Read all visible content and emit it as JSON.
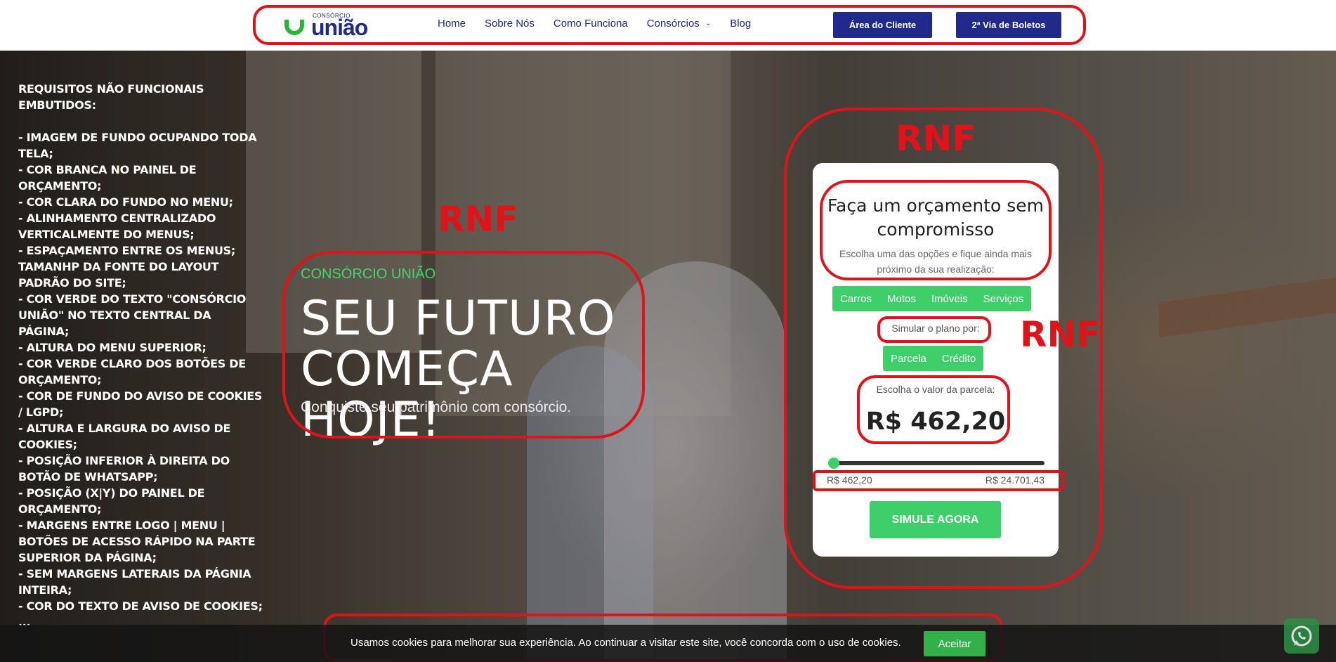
{
  "header": {
    "logo_small": "CONSÓRCIO",
    "logo_big": "união",
    "nav": [
      {
        "label": "Home"
      },
      {
        "label": "Sobre Nós"
      },
      {
        "label": "Como Funciona"
      },
      {
        "label": "Consórcios"
      },
      {
        "label": "Blog"
      }
    ],
    "btn_area_cliente": "Área do Cliente",
    "btn_boletos": "2ª Via de Boletos"
  },
  "requirements": {
    "title": "REQUISITOS NÃO FUNCIONAIS EMBUTIDOS:",
    "items": [
      "- IMAGEM DE FUNDO OCUPANDO TODA TELA;",
      "- COR BRANCA NO PAINEL DE ORÇAMENTO;",
      "- COR CLARA DO FUNDO NO MENU;",
      "- ALINHAMENTO CENTRALIZADO VERTICALMENTE DO MENUS;",
      "- ESPAÇAMENTO ENTRE OS MENUS; TAMANHP DA FONTE DO LAYOUT PADRÃO DO SITE;",
      "- COR VERDE DO TEXTO \"CONSÓRCIO UNIÃO\" NO TEXTO CENTRAL DA PÁGINA;",
      "- ALTURA DO MENU SUPERIOR;",
      "- COR VERDE CLARO DOS BOTÕES DE ORÇAMENTO;",
      "- COR DE FUNDO DO AVISO DE COOKIES / LGPD;",
      "- ALTURA E LARGURA DO AVISO DE COOKIES;",
      "- POSIÇÃO INFERIOR À DIREITA DO BOTÃO DE WHATSAPP;",
      "- POSIÇÃO (X|Y) DO PAINEL DE ORÇAMENTO;",
      "- MARGENS ENTRE LOGO | MENU | BOTÕES DE ACESSO RÁPIDO NA PARTE SUPERIOR DA PÁGINA;",
      "- SEM MARGENS LATERAIS DA PÁGNIA INTEIRA;",
      "- COR DO TEXTO DE AVISO DE COOKIES; ..."
    ]
  },
  "hero": {
    "brand": "CONSÓRCIO UNIÃO",
    "title_line1": "SEU FUTURO",
    "title_line2": "COMEÇA HOJE!",
    "subtitle": "Conquiste seu patrimônio com consórcio."
  },
  "annotations": {
    "rnf_hero": "RNF",
    "rnf_panel_top": "RNF",
    "rnf_panel_side": "RNF"
  },
  "panel": {
    "title_line1": "Faça um orçamento sem",
    "title_line2": "compromisso",
    "description": "Escolha uma das opções e fique ainda mais próximo da sua realização:",
    "categories": [
      {
        "label": "Carros"
      },
      {
        "label": "Motos"
      },
      {
        "label": "Imóveis"
      },
      {
        "label": "Serviços"
      }
    ],
    "plan_label": "Simular o plano por:",
    "plan_options": [
      {
        "label": "Parcela"
      },
      {
        "label": "Crédito"
      }
    ],
    "value_label": "Escolha o valor da parcela:",
    "amount": "R$ 462,20",
    "slider_fraction": 0.0,
    "range_min": "R$ 462,20",
    "range_max": "R$ 24.701,43",
    "cta": "SIMULE AGORA"
  },
  "cookie": {
    "text": "Usamos cookies para melhorar sua experiência. Ao continuar a visitar este site, você concorda com o uso de cookies.",
    "accept": "Aceitar"
  },
  "colors": {
    "brand_blue": "#1f2a8a",
    "brand_green": "#3fcf6a",
    "annotation_red": "#e0131a"
  },
  "icons": {
    "whatsapp": "whatsapp-icon",
    "dropdown": "chevron-down-icon"
  }
}
